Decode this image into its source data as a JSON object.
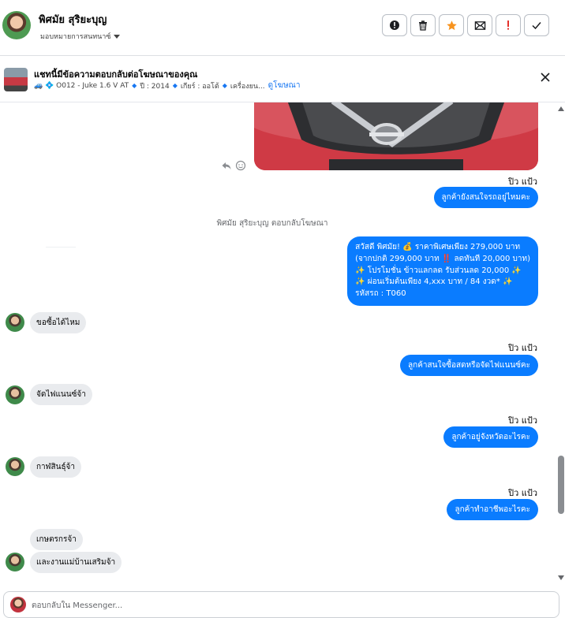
{
  "header": {
    "contact_name": "พิศมัย สุริยะบุญ",
    "assign_label": "มอบหมายการสนทนาซ์",
    "actions": [
      {
        "icon": "alert-circle-icon"
      },
      {
        "icon": "trash-icon"
      },
      {
        "icon": "star-icon"
      },
      {
        "icon": "mark-unread-icon"
      },
      {
        "icon": "exclamation-icon"
      },
      {
        "icon": "check-icon"
      }
    ]
  },
  "ad": {
    "title": "แชทนี้มีข้อความตอบกลับต่อโฆษณาของคุณ",
    "code": "🚙 💠 O012 - Juke 1.6 V AT",
    "year": "ปี : 2014",
    "gear": "เกียร์ : ออโต้",
    "engine": "เครื่องยน...",
    "view_ad": "ดูโฆษณา"
  },
  "messages": {
    "sender_1": "ปิว แป้ว",
    "out_1": "ลูกค้ายังสนใจรถอยู่ไหมคะ",
    "system": "พิศมัย สุริยะบุญ ตอบกลับโฆษณา",
    "promo_1": "สวัสดี พิศมัย! 💰 ราคาพิเศษเพียง 279,000 บาท",
    "promo_2": "(จากปกติ 299,000 บาท ‼️ ลดทันที 20,000 บาท)",
    "promo_3": "✨ โปรโมชั่น ข้าวแลกลด รับส่วนลด 20,000 ✨",
    "promo_4": "✨ ผ่อนเริ่มต้นเพียง 4,xxx บาท / 84 งวด* ✨",
    "promo_5": "รหัสรถ : T060",
    "in_1": "ขอซื้อได้ไหม",
    "sender_2": "ปิว แป้ว",
    "out_2": "ลูกค้าสนใจซื้อสดหรือจัดไฟแนนซ์คะ",
    "in_2": "จัดไฟแนนซ์จ้า",
    "sender_3": "ปิว แป้ว",
    "out_3": "ลูกค้าอยู่จังหวัดอะไรคะ",
    "in_3": "กาฬสินธุ์จ้า",
    "sender_4": "ปิว แป้ว",
    "out_4": "ลูกค้าทำอาชีพอะไรคะ",
    "in_4": "เกษตรกรจ้า",
    "in_5": "และงานแม่บ้านเสริมจ้า"
  },
  "composer": {
    "placeholder": "ตอบกลับใน Messenger..."
  },
  "colors": {
    "accent": "#0a7cff",
    "incoming_bubble": "#e9ebee",
    "star": "#f7931e",
    "exclamation": "#e4312b"
  }
}
